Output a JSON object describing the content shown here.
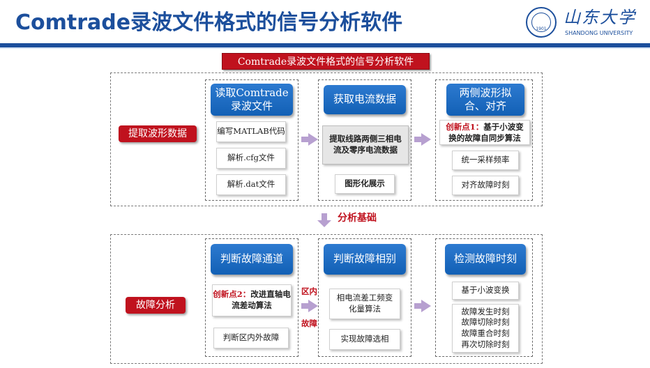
{
  "header": {
    "title": "Comtrade录波文件格式的信号分析软件",
    "logo_cn": "山东大学",
    "logo_en": "SHANDONG UNIVERSITY",
    "logo_year": "1901"
  },
  "banner": "Comtrade录波文件格式的信号分析软件",
  "top_section": {
    "label": "提取波形数据",
    "stage1": {
      "head_lines": [
        "读取Comtrade",
        "录波文件"
      ],
      "items": [
        "编写MATLAB代码",
        "解析.cfg文件",
        "解析.dat文件"
      ]
    },
    "stage2": {
      "head": "获取电流数据",
      "items": [
        "提取线路两侧三相电流及零序电流数据",
        "图形化展示"
      ]
    },
    "stage3": {
      "head_lines": [
        "两侧波形拟",
        "合、对齐"
      ],
      "innovation_prefix": "创新点1：",
      "innovation_text": "基于小波变换的故障自同步算法",
      "items": [
        "统一采样频率",
        "对齐故障时刻"
      ]
    }
  },
  "middle": {
    "label": "分析基础"
  },
  "bottom_section": {
    "label": "故障分析",
    "stage1": {
      "head": "判断故障通道",
      "innovation_prefix": "创新点2：",
      "innovation_text": "改进直轴电流差动算法",
      "items": [
        "判断区内外故障"
      ]
    },
    "between_label_top": "区内",
    "between_label_bottom": "故障",
    "stage2": {
      "head": "判断故障相别",
      "items": [
        "相电流差工频变化量算法",
        "实现故障选相"
      ]
    },
    "stage3": {
      "head": "检测故障时刻",
      "items": [
        "基于小波变换"
      ],
      "times": [
        "故障发生时刻",
        "故障切除时刻",
        "故障重合时刻",
        "再次切除时刻"
      ]
    }
  },
  "colors": {
    "brand_blue": "#1c4f9c",
    "accent_red": "#c0121e",
    "head_blue": "#1a6cc4",
    "arrow": "#b7a0d0"
  }
}
